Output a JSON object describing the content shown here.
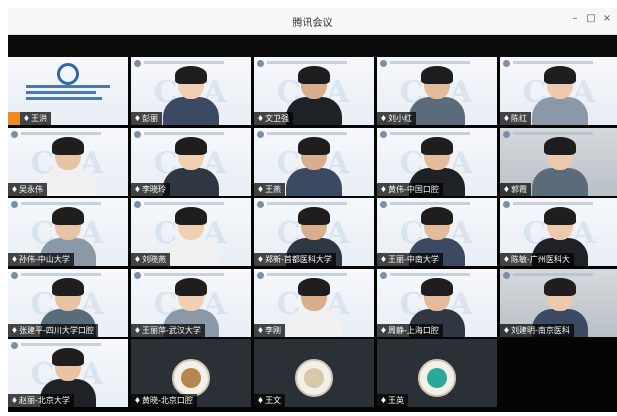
{
  "window": {
    "title": "腾讯会议",
    "controls": {
      "minimize": "–",
      "maximize": "□",
      "close": "×"
    }
  },
  "watermark_text": "CSA",
  "colors": {
    "host_badge": "#f08a22",
    "grid_bg": "#050505"
  },
  "tiles": [
    {
      "name": "王洪",
      "kind": "org"
    },
    {
      "name": "彭丽",
      "kind": "light"
    },
    {
      "name": "文卫强",
      "kind": "light"
    },
    {
      "name": "刘小红",
      "kind": "light"
    },
    {
      "name": "陈红",
      "kind": "light"
    },
    {
      "name": "吴永伟",
      "kind": "light"
    },
    {
      "name": "李晓玲",
      "kind": "light"
    },
    {
      "name": "王燕",
      "kind": "light"
    },
    {
      "name": "黄伟-中国口腔",
      "kind": "light"
    },
    {
      "name": "郭霞",
      "kind": "room"
    },
    {
      "name": "孙伟-中山大学",
      "kind": "light"
    },
    {
      "name": "刘晓燕",
      "kind": "light"
    },
    {
      "name": "郑新-首都医科大学",
      "kind": "light"
    },
    {
      "name": "王丽-中南大学",
      "kind": "light"
    },
    {
      "name": "陈敏-广州医科大",
      "kind": "light"
    },
    {
      "name": "张建平-四川大学口腔",
      "kind": "light"
    },
    {
      "name": "王丽萍-武汉大学",
      "kind": "light"
    },
    {
      "name": "李刚",
      "kind": "light"
    },
    {
      "name": "周静-上海口腔",
      "kind": "light"
    },
    {
      "name": "刘建明-南京医科",
      "kind": "room"
    },
    {
      "name": "赵丽-北京大学",
      "kind": "light"
    },
    {
      "name": "黄晓-北京口腔",
      "kind": "dark"
    },
    {
      "name": "王文",
      "kind": "dark"
    },
    {
      "name": "王英",
      "kind": "dark"
    }
  ]
}
